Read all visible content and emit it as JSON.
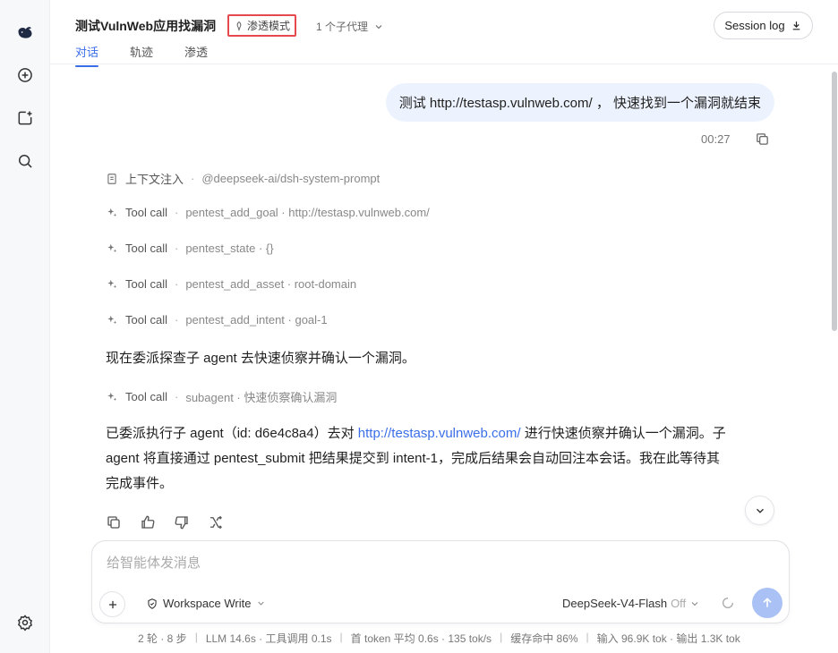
{
  "header": {
    "title": "测试VulnWeb应用找漏洞",
    "mode_badge": "渗透模式",
    "agent_count": "1 个子代理",
    "session_log": "Session log",
    "tabs": [
      {
        "label": "对话",
        "active": true
      },
      {
        "label": "轨迹",
        "active": false
      },
      {
        "label": "渗透",
        "active": false
      }
    ]
  },
  "conversation": {
    "user_message": "测试  http://testasp.vulnweb.com/ ，  快速找到一个漏洞就结束",
    "user_time": "00:27",
    "steps": [
      {
        "icon": "document-icon",
        "label": "上下文注入",
        "detail": "@deepseek-ai/dsh-system-prompt"
      },
      {
        "icon": "sparkle-icon",
        "label": "Tool call",
        "detail": "pentest_add_goal · http://testasp.vulnweb.com/"
      },
      {
        "icon": "sparkle-icon",
        "label": "Tool call",
        "detail": "pentest_state · {}"
      },
      {
        "icon": "sparkle-icon",
        "label": "Tool call",
        "detail": "pentest_add_asset · root-domain"
      },
      {
        "icon": "sparkle-icon",
        "label": "Tool call",
        "detail": "pentest_add_intent · goal-1"
      }
    ],
    "assistant_text_1": "现在委派探查子 agent 去快速侦察并确认一个漏洞。",
    "step_subagent": {
      "icon": "sparkle-icon",
      "label": "Tool call",
      "detail": "subagent · 快速侦察确认漏洞"
    },
    "assistant_text_2": {
      "line1_pre": "已委派执行子 agent（id: d6e4c8a4）去对 ",
      "link": "http://testasp.vulnweb.com/",
      "line1_post": " 进行快速侦察并确认一个漏洞。子",
      "line2": "agent 将直接通过 pentest_submit 把结果提交到 intent-1，完成后结果会自动回注本会话。我在此等待其",
      "line3": "完成事件。"
    }
  },
  "composer": {
    "placeholder": "给智能体发消息",
    "workspace": "Workspace Write",
    "model": "DeepSeek-V4-Flash",
    "model_state": "Off"
  },
  "stats": [
    "2 轮 · 8 步",
    "LLM 14.6s · 工具调用 0.1s",
    "首 token 平均 0.6s · 135 tok/s",
    "缓存命中 86%",
    "输入 96.9K tok · 输出 1.3K tok"
  ],
  "colors": {
    "accent": "#3a6ee8",
    "badge_border": "#e5484d",
    "user_bubble": "#edf3fe",
    "send_button": "#a9c1f4"
  }
}
